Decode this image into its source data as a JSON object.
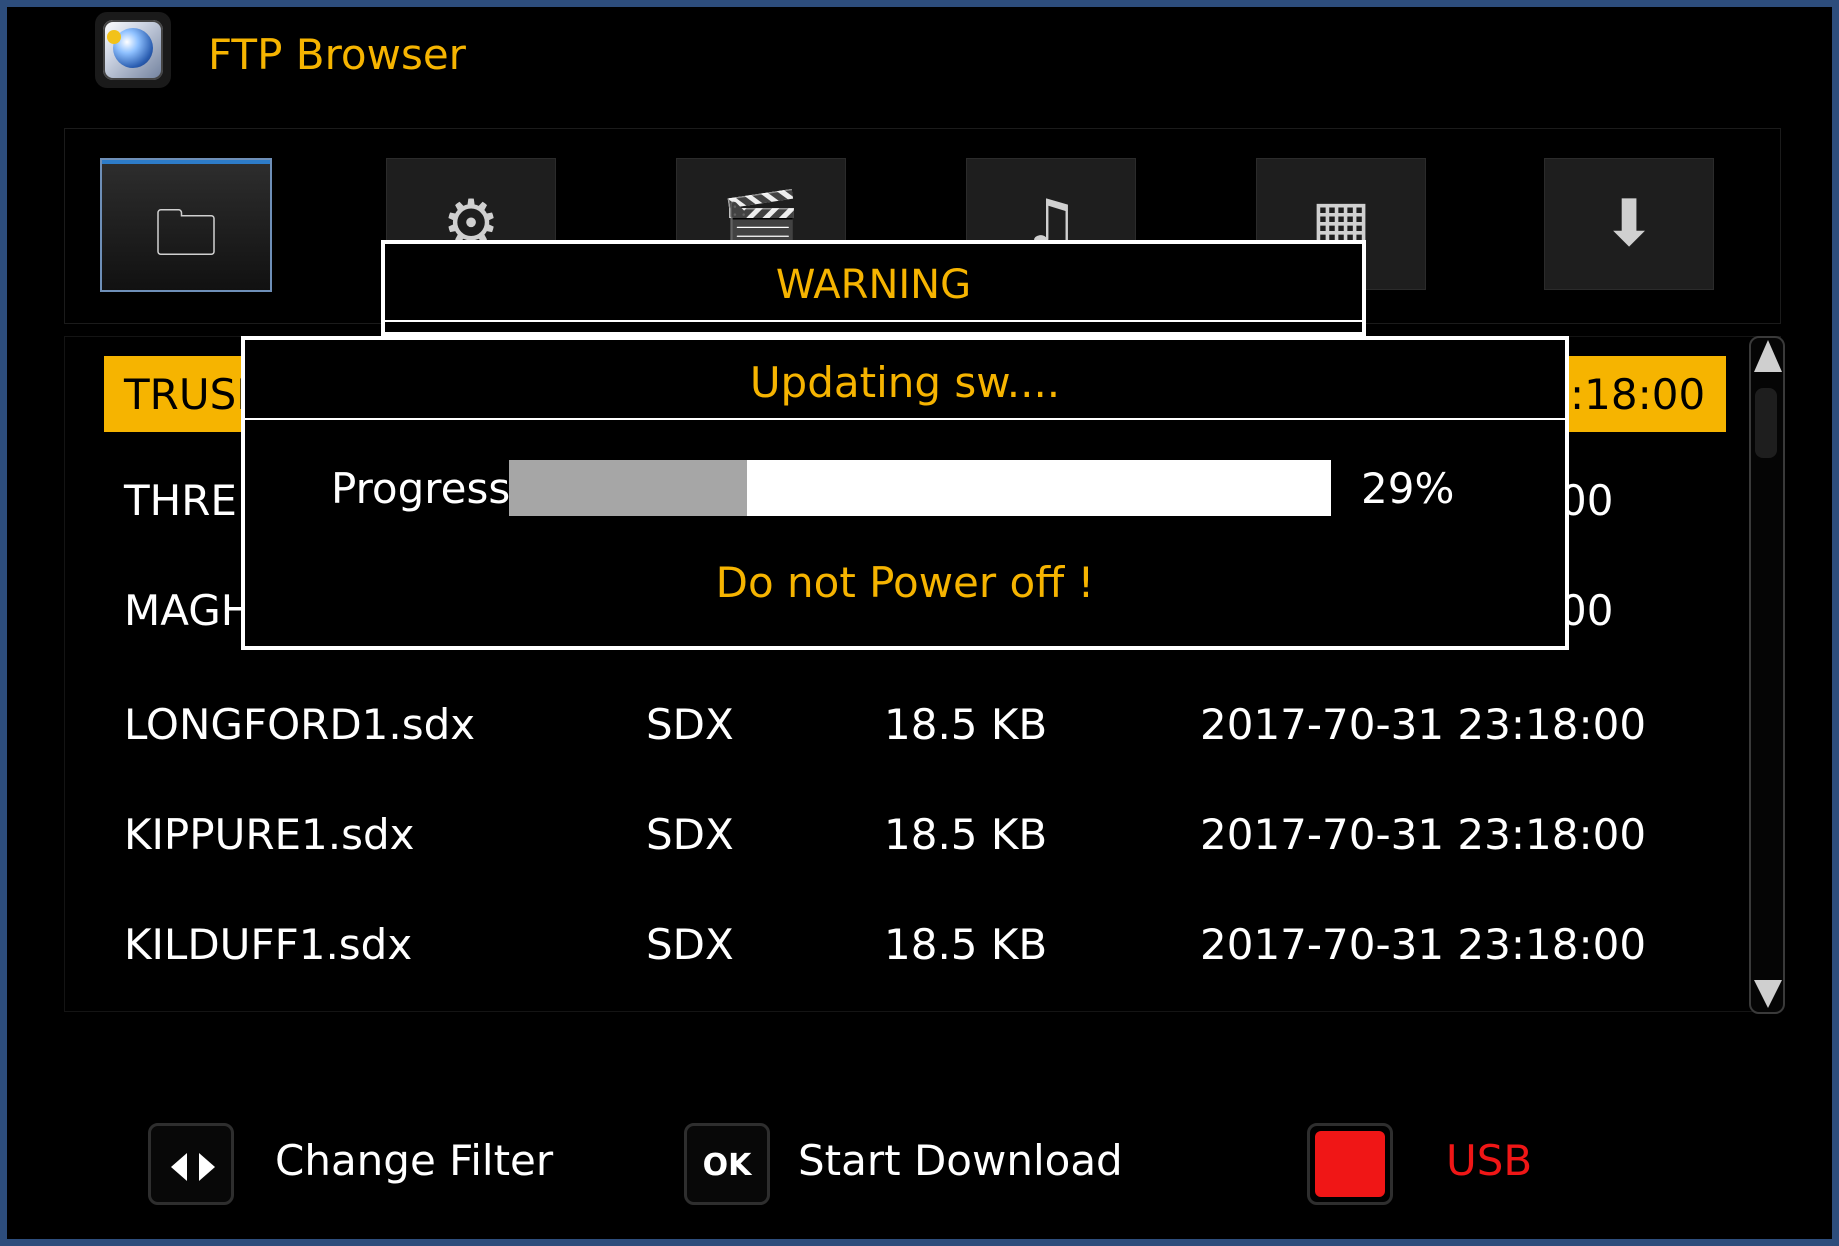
{
  "header": {
    "title": "FTP Browser",
    "logo_icon": "ftp-globe-icon"
  },
  "categories": [
    {
      "icon": "folder-icon",
      "glyph": "🗀",
      "active": true
    },
    {
      "icon": "settings-icon",
      "glyph": "⚙",
      "active": false
    },
    {
      "icon": "clapperboard-icon",
      "glyph": "🎬",
      "active": false
    },
    {
      "icon": "music-icon",
      "glyph": "♫",
      "active": false
    },
    {
      "icon": "photos-icon",
      "glyph": "▦",
      "active": false
    },
    {
      "icon": "download-icon",
      "glyph": "⬇",
      "active": false
    }
  ],
  "files": [
    {
      "name": "TRUSK",
      "type": "",
      "size": "",
      "date": ":18:00",
      "selected": true
    },
    {
      "name": "THREE",
      "type": "",
      "size": "",
      "date": "00",
      "selected": false
    },
    {
      "name": "MAGH",
      "type": "",
      "size": "",
      "date": "00",
      "selected": false
    },
    {
      "name": "LONGFORD1.sdx",
      "type": "SDX",
      "size": "18.5 KB",
      "date": "2017-70-31 23:18:00",
      "selected": false
    },
    {
      "name": "KIPPURE1.sdx",
      "type": "SDX",
      "size": "18.5 KB",
      "date": "2017-70-31 23:18:00",
      "selected": false
    },
    {
      "name": "KILDUFF1.sdx",
      "type": "SDX",
      "size": "18.5 KB",
      "date": "2017-70-31 23:18:00",
      "selected": false
    }
  ],
  "warning_dialog": {
    "title": "WARNING"
  },
  "update_dialog": {
    "title": "Updating sw....",
    "progress_label": "Progress",
    "progress_percent": 29,
    "progress_text": "29%",
    "message": "Do not Power off !"
  },
  "footer": {
    "filter_key_icon": "left-right-arrows-icon",
    "filter_label": "Change Filter",
    "ok_key_label": "OK",
    "download_label": "Start Download",
    "usb_label": "USB"
  },
  "colors": {
    "accent": "#f6b400",
    "usb_red": "#f01616",
    "frame_blue": "#2d4d7c",
    "progress_fill": "#a6a6a6"
  }
}
